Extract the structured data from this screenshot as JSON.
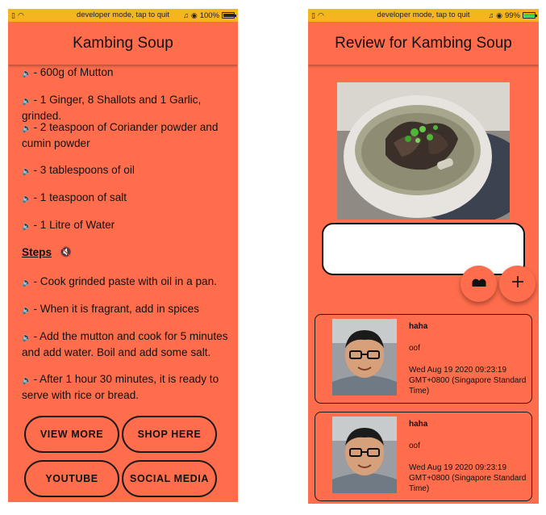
{
  "left_screen": {
    "status": {
      "center": "developer mode, tap to quit",
      "battery": "100%",
      "battery_level": 1.0
    },
    "title": "Kambing Soup",
    "ingredients": [
      "- 600g of Mutton",
      "- 1 Ginger, 8 Shallots and 1 Garlic, grinded.",
      "- 2 teaspoon of Coriander powder and cumin powder",
      "- 3 tablespoons of oil",
      "- 1 teaspoon of salt",
      "- 1 Litre of Water"
    ],
    "steps_label": "Steps",
    "steps": [
      "- Cook grinded paste with oil in a pan.",
      "- When it is fragrant, add in spices",
      "- Add the mutton and cook for 5 minutes and add water. Boil and add some salt.",
      "- After 1 hour 30 minutes, it is ready to serve with rice or bread."
    ],
    "buttons": {
      "view_more": "VIEW MORE",
      "shop_here": "SHOP HERE",
      "youtube": "YOUTUBE",
      "social_media": "SOCIAL MEDIA"
    }
  },
  "right_screen": {
    "status": {
      "center": "developer mode, tap to quit",
      "battery": "99%",
      "battery_level": 0.99,
      "charging": true
    },
    "title": "Review for Kambing Soup",
    "review_input_value": "",
    "reviews": [
      {
        "name": "haha",
        "text": "oof",
        "date": "Wed Aug 19 2020 09:23:19 GMT+0800 (Singapore Standard Time)"
      },
      {
        "name": "haha",
        "text": "oof",
        "date": "Wed Aug 19 2020 09:23:19 GMT+0800 (Singapore Standard Time)"
      }
    ]
  },
  "icons": {
    "speaker": "speaker-icon",
    "quote": "quote-icon",
    "plus": "plus-icon"
  },
  "colors": {
    "background": "#ff6d4c",
    "statusbar": "#f5b51f",
    "text": "#111111"
  }
}
